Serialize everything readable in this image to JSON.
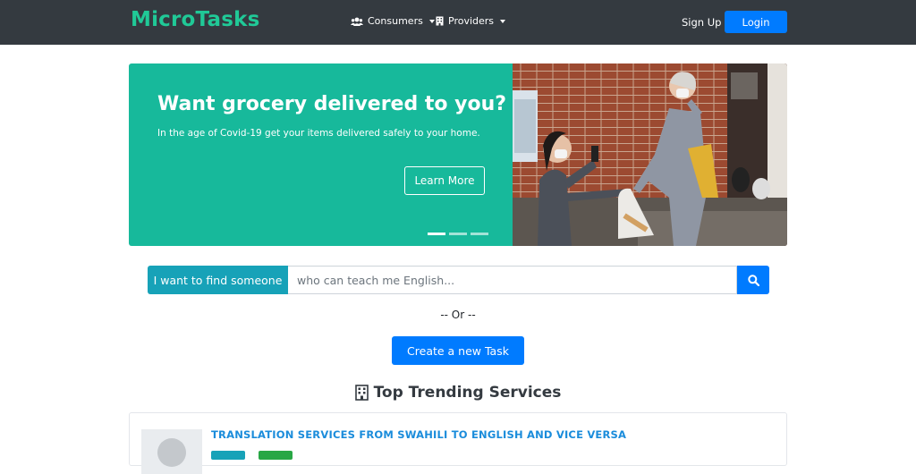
{
  "navbar": {
    "brand": "MicroTasks",
    "consumers_label": "Consumers",
    "providers_label": "Providers",
    "signup_label": "Sign Up",
    "login_label": "Login"
  },
  "hero": {
    "title": "Want grocery delivered to you?",
    "subtitle": "In the age of Covid-19 get your items delivered safely to your home.",
    "button_label": "Learn More",
    "slide_count": 3,
    "active_slide": 1
  },
  "search": {
    "label": "I want to find someone",
    "placeholder": "who can teach me English..."
  },
  "or_text": "-- Or --",
  "create_task_label": "Create a new Task",
  "trending": {
    "title": "Top Trending Services",
    "items": [
      {
        "title": "TRANSLATION SERVICES FROM SWAHILI TO ENGLISH AND VICE VERSA"
      }
    ]
  },
  "colors": {
    "navbar": "#343a40",
    "brand": "#20c997",
    "primary": "#007bff",
    "info": "#17a2b8",
    "hero_bg": "#17b99b"
  }
}
